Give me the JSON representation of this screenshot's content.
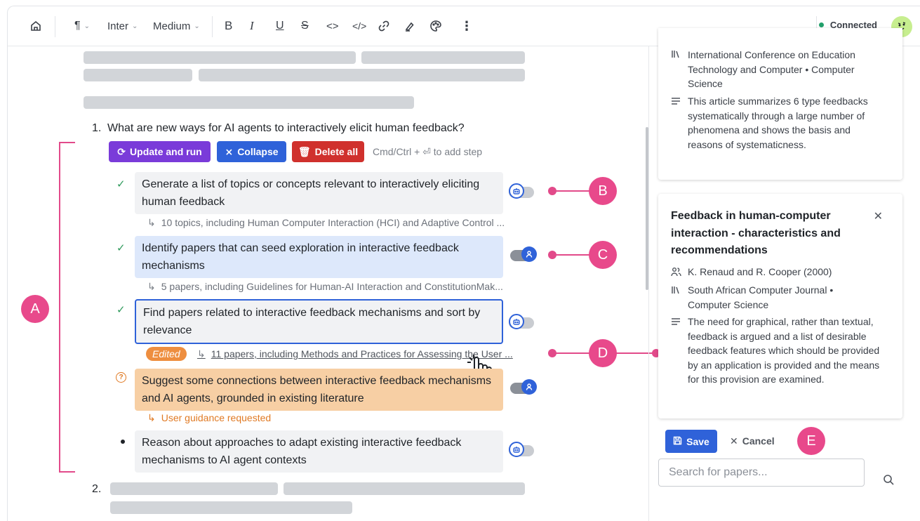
{
  "toolbar": {
    "paragraph_caret": "⌄",
    "font_family": "Inter",
    "font_weight": "Medium",
    "status": "Connected",
    "status_color": "#22a06b"
  },
  "editor": {
    "question1_number": "1.",
    "question1_text": "What are new ways for AI agents to interactively elicit human feedback?",
    "question2_number": "2.",
    "buttons": {
      "update_run": "Update and run",
      "collapse": "Collapse",
      "delete_all": "Delete all"
    },
    "hint": "Cmd/Ctrl + ⏎ to add step",
    "steps": [
      {
        "text": "Generate a list of topics or concepts relevant to interactively eliciting human feedback",
        "result": "10 topics, including Human Computer Interaction (HCI) and Adaptive Control ...",
        "status": "done"
      },
      {
        "text": "Identify papers that can seed exploration in interactive feedback mechanisms",
        "result": "5 papers, including Guidelines for Human-AI Interaction and ConstitutionMak...",
        "status": "done"
      },
      {
        "text": "Find papers related to interactive feedback mechanisms and sort by relevance",
        "result": "11 papers, including Methods and Practices for Assessing the User ...",
        "status": "done",
        "edited_label": "Edited"
      },
      {
        "text": "Suggest some connections between interactive feedback mechanisms and AI agents, grounded in existing literature",
        "result": "User guidance requested",
        "status": "question"
      },
      {
        "text": "Reason about approaches to adapt existing interactive feedback mechanisms to AI agent contexts",
        "status": "pending"
      }
    ]
  },
  "annotations": {
    "a": "A",
    "b": "B",
    "c": "C",
    "d": "D",
    "e": "E",
    "color": "#e8498b"
  },
  "panel": {
    "card1": {
      "venue": "International Conference on Education Technology and Computer • Computer Science",
      "summary": "This article summarizes 6 type feedbacks systematically through a large number of phenomena and shows the basis and reasons of systematicness."
    },
    "card2": {
      "title": "Feedback in human-computer interaction - characteristics and recommendations",
      "authors": "K. Renaud and R. Cooper (2000)",
      "venue": "South African Computer Journal • Computer Science",
      "summary": "The need for graphical, rather than textual, feedback is argued and a list of desirable feedback features which should be provided by an application is provided and the means for this provision are examined."
    },
    "save_label": "Save",
    "cancel_label": "Cancel",
    "search_placeholder": "Search for papers..."
  },
  "colors": {
    "purple": "#7a3bd9",
    "blue": "#2f62d9",
    "red": "#d0312d",
    "orange": "#ee8e3f",
    "step_blue_bg": "#dde8fb",
    "step_orange_bg": "#f7cfa4",
    "step_gray_bg": "#f1f2f4"
  }
}
